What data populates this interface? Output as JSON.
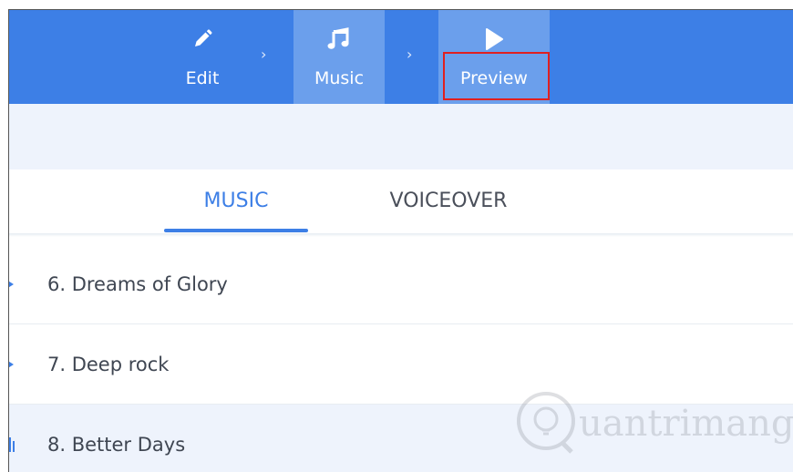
{
  "steps": [
    {
      "label": "Edit",
      "icon": "pencil-icon"
    },
    {
      "label": "Music",
      "icon": "music-note-icon"
    },
    {
      "label": "Preview",
      "icon": "play-icon"
    }
  ],
  "chevron": "›",
  "tabs": {
    "music": "MUSIC",
    "voiceover": "VOICEOVER"
  },
  "tracks": [
    {
      "title": "6. Dreams of Glory",
      "state": "play-indicator"
    },
    {
      "title": "7. Deep rock",
      "state": "play-indicator"
    },
    {
      "title": "8. Better Days",
      "state": "equalizer-indicator",
      "selected": true
    }
  ],
  "colors": {
    "accent": "#3d7fe6",
    "active_step": "#6b9fec",
    "highlight_box": "#e02020",
    "selected_row": "#eef3fc"
  },
  "watermark": "uantrimang"
}
